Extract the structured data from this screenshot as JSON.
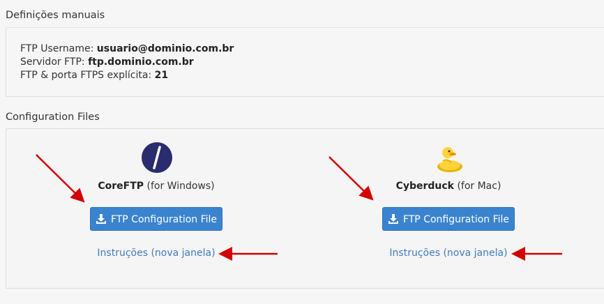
{
  "manual": {
    "title": "Definições manuais",
    "username_label": "FTP Username:",
    "username_value": "usuario@dominio.com.br",
    "server_label": "Servidor FTP:",
    "server_value": "ftp.dominio.com.br",
    "port_label": "FTP & porta FTPS explícita:",
    "port_value": "21"
  },
  "config": {
    "title": "Configuration Files",
    "clients": [
      {
        "name": "CoreFTP",
        "platform": "(for Windows)",
        "button_label": "FTP Configuration File",
        "link_label": "Instruções (nova janela)",
        "icon": "coreftp-logo-icon"
      },
      {
        "name": "Cyberduck",
        "platform": "(for Mac)",
        "button_label": "FTP Configuration File",
        "link_label": "Instruções (nova janela)",
        "icon": "cyberduck-logo-icon"
      }
    ]
  },
  "colors": {
    "button": "#3a84cf",
    "link": "#3f7bbd",
    "annotation_arrow": "#d40000"
  }
}
